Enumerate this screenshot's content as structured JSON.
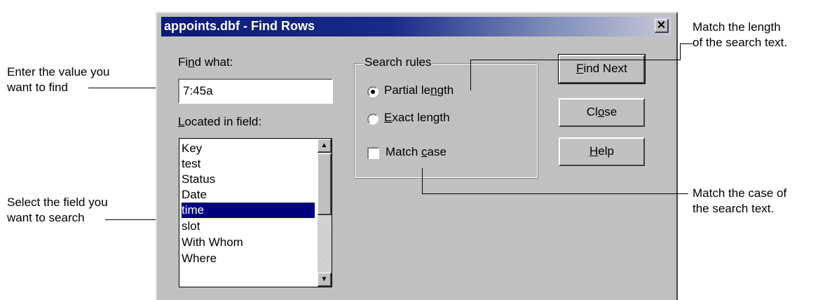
{
  "window": {
    "title": "appoints.dbf - Find Rows",
    "close_glyph": "✕"
  },
  "find": {
    "label_pre": "Fi",
    "label_key": "n",
    "label_post": "d what:",
    "value": "7:45a"
  },
  "located": {
    "label_key": "L",
    "label_post": "ocated in field:",
    "items": [
      "Key",
      "test",
      "Status",
      "Date",
      "time",
      "slot",
      "With Whom",
      "Where"
    ],
    "selected": "time"
  },
  "search_rules": {
    "title": "Search rules",
    "partial": {
      "pre": "Partial le",
      "key": "n",
      "post": "gth",
      "checked": true
    },
    "exact": {
      "key": "E",
      "post": "xact length",
      "checked": false
    },
    "match_case": {
      "pre": "Match ",
      "key": "c",
      "post": "ase",
      "checked": false
    }
  },
  "buttons": {
    "find_next": {
      "key": "F",
      "post": "ind Next"
    },
    "close": {
      "pre": "Cl",
      "key": "o",
      "post": "se"
    },
    "help": {
      "key": "H",
      "post": "elp"
    }
  },
  "callouts": {
    "enter_1": "Enter the value you",
    "enter_2": "want to find",
    "select_1": "Select the field you",
    "select_2": "want to search",
    "length_1": "Match the length",
    "length_2": "of the search text.",
    "case_1": "Match the case of",
    "case_2": "the search text."
  },
  "icons": {
    "scroll_up": "scroll-up-arrow-icon",
    "scroll_down": "scroll-down-arrow-icon",
    "close": "close-x-icon"
  }
}
